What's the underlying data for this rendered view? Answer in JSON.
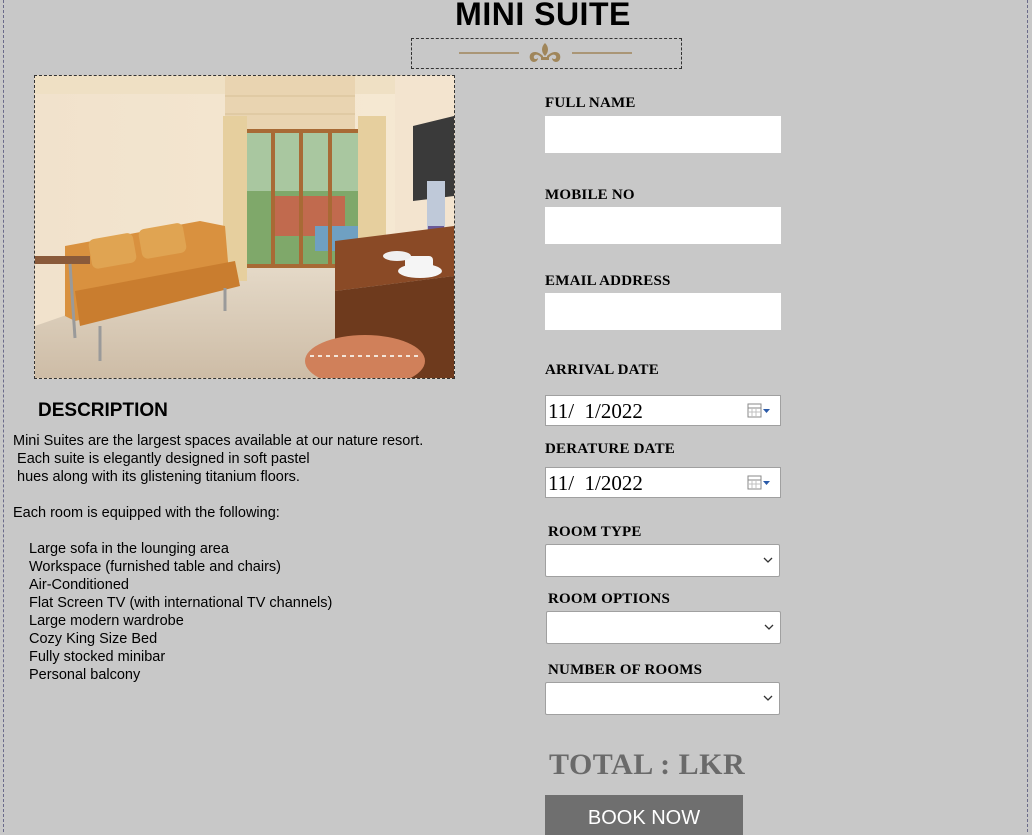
{
  "page": {
    "title": "MINI SUITE",
    "accent_color": "#a0865a"
  },
  "description": {
    "heading": "DESCRIPTION",
    "lines": [
      "Mini Suites are the largest spaces available at our nature resort.",
      " Each suite is elegantly designed in soft pastel",
      " hues along with its glistening titanium floors.",
      "Each room is equipped with the following:"
    ],
    "amenities": [
      "Large sofa in the lounging area",
      "Workspace (furnished table and chairs)",
      "Air-Conditioned",
      "Flat Screen TV (with international TV channels)",
      "Large modern wardrobe",
      "Cozy King Size Bed",
      "Fully stocked minibar",
      "Personal balcony"
    ]
  },
  "form": {
    "full_name_label": "FULL  NAME",
    "full_name_value": "",
    "mobile_label": "MOBILE NO",
    "mobile_value": "",
    "email_label": "EMAIL ADDRESS",
    "email_value": "",
    "arrival_label": "ARRIVAL DATE",
    "arrival_value": "11/  1/2022",
    "departure_label": "DERATURE DATE",
    "departure_value": "11/  1/2022",
    "room_type_label": "ROOM TYPE",
    "room_type_value": "",
    "room_options_label": "ROOM OPTIONS",
    "room_options_value": "",
    "num_rooms_label": "NUMBER OF ROOMS",
    "num_rooms_value": "",
    "total_label": "TOTAL : LKR",
    "book_label": "BOOK NOW"
  },
  "icons": {
    "ornament": "fleur-de-lis-divider-icon",
    "calendar": "calendar-icon",
    "dropdown": "chevron-down-icon",
    "photo": "suite-room-photo"
  }
}
